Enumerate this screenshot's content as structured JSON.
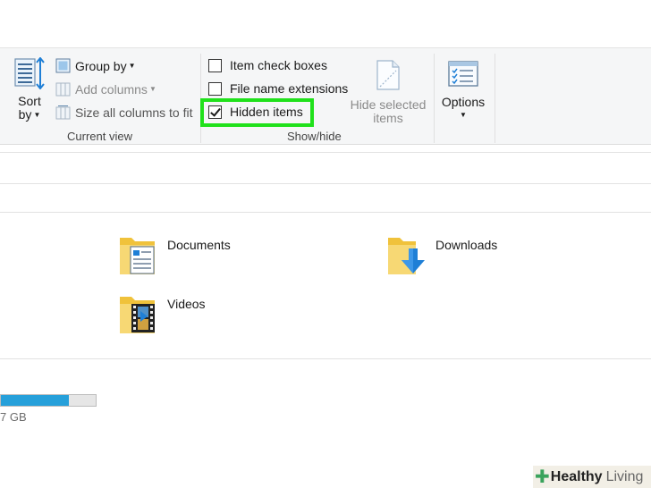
{
  "ribbon": {
    "current_view": {
      "sort_line1": "Sort",
      "sort_line2": "by",
      "group_by": "Group by",
      "add_columns": "Add columns",
      "size_all_columns": "Size all columns to fit",
      "label": "Current view"
    },
    "show_hide": {
      "item_check_boxes": {
        "label": "Item check boxes",
        "checked": false
      },
      "file_name_extensions": {
        "label": "File name extensions",
        "checked": false
      },
      "hidden_items": {
        "label": "Hidden items",
        "checked": true
      },
      "hide_selected_line1": "Hide selected",
      "hide_selected_line2": "items",
      "label": "Show/hide"
    },
    "options": {
      "label": "Options"
    }
  },
  "folders": [
    {
      "name": "Documents",
      "icon": "documents-folder-icon"
    },
    {
      "name": "Downloads",
      "icon": "downloads-folder-icon"
    },
    {
      "name": "Videos",
      "icon": "videos-folder-icon"
    }
  ],
  "drive": {
    "used_fraction": 0.72,
    "size_text": "7 GB"
  },
  "watermark": {
    "brand": "Healthy",
    "brand2": "Living"
  },
  "colors": {
    "highlight": "#20e11b",
    "drive_fill": "#26a0da",
    "folder_yellow": "#f0c23b",
    "download_arrow": "#1f7fd6"
  }
}
